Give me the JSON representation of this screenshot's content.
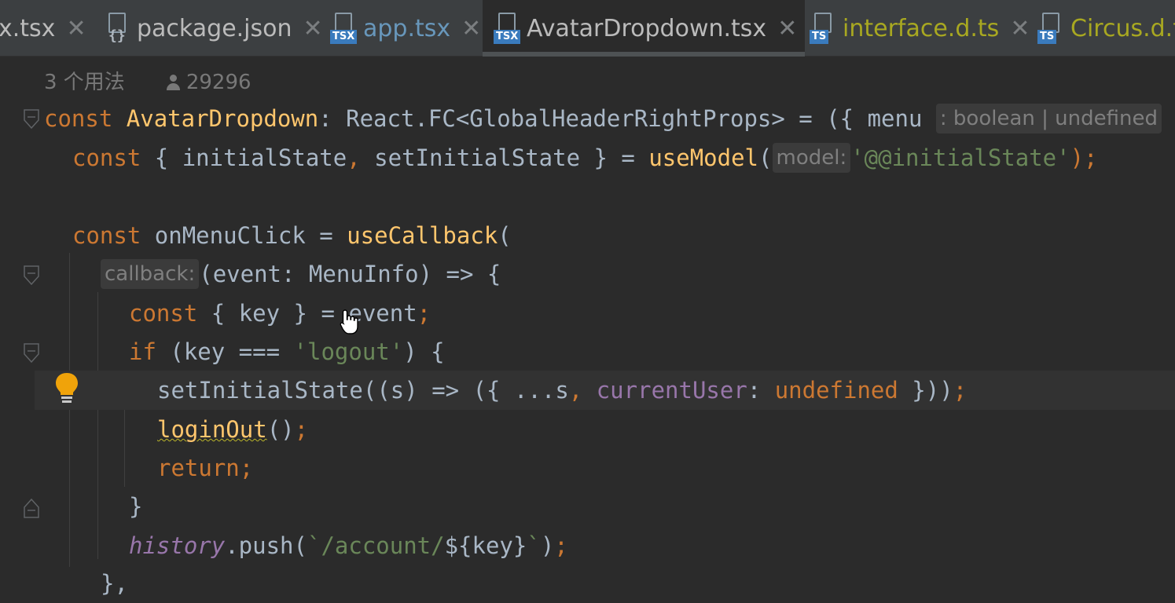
{
  "tabs": [
    {
      "label": "x.tsx",
      "icon": "none",
      "color": "#bbbbbb",
      "active": false
    },
    {
      "label": "package.json",
      "icon": "json-file-icon",
      "color": "#bbbbbb",
      "active": false
    },
    {
      "label": "app.tsx",
      "icon": "tsx-file-icon",
      "color": "#6897bb",
      "active": false
    },
    {
      "label": "AvatarDropdown.tsx",
      "icon": "tsx-file-icon",
      "color": "#bbbbbb",
      "active": true
    },
    {
      "label": "interface.d.ts",
      "icon": "ts-file-icon",
      "color": "#a8a821",
      "active": false
    },
    {
      "label": "Circus.d.t",
      "icon": "ts-file-icon",
      "color": "#a8a821",
      "active": false
    }
  ],
  "badges": {
    "tsx": "TSX",
    "ts": "TS"
  },
  "usage_hint": {
    "usages": "3 个用法",
    "author": "29296"
  },
  "code": {
    "l1_kw": "const",
    "l1_name": "AvatarDropdown",
    "l1_rest": ": React.FC<GlobalHeaderRightProps> = ({ menu",
    "l1_hint": ": boolean | undefined",
    "l2_kw": "const",
    "l2_a": " { initialState",
    "l2_comma": ",",
    "l2_b": " setInitialState } = ",
    "l2_fn": "useModel",
    "l2_paren": "(",
    "l2_hint": "model:",
    "l2_str": "'@@initialState'",
    "l2_end": ");",
    "l4_kw": "const",
    "l4_a": " onMenuClick = ",
    "l4_fn": "useCallback",
    "l4_b": "(",
    "l5_hint": "callback:",
    "l5_a": "(event: MenuInfo) => {",
    "l6_kw": "const",
    "l6_a": " { key } = event",
    "l6_semi": ";",
    "l7_kw": "if",
    "l7_a": " (key === ",
    "l7_str": "'logout'",
    "l7_b": ") {",
    "l8_a": "setInitialState((s) => ({ ...s",
    "l8_comma": ",",
    "l8_prop": " currentUser",
    "l8_colon": ": ",
    "l8_kw": "undefined",
    "l8_b": " }))",
    "l8_semi": ";",
    "l9_fn": "loginOut",
    "l9_a": "()",
    "l9_semi": ";",
    "l10_kw": "return",
    "l10_semi": ";",
    "l11_a": "}",
    "l12_hist": "history",
    "l12_a": ".push(",
    "l12_str": "`/account/",
    "l12_b": "${key}",
    "l12_str2": "`",
    "l12_c": ")",
    "l12_semi": ";",
    "l13_a": "},"
  },
  "colors": {
    "keyword": "#cc7832",
    "function": "#ffc66d",
    "string": "#6a8759",
    "property": "#9876aa",
    "text": "#a9b7c6",
    "background": "#2b2b2b"
  }
}
